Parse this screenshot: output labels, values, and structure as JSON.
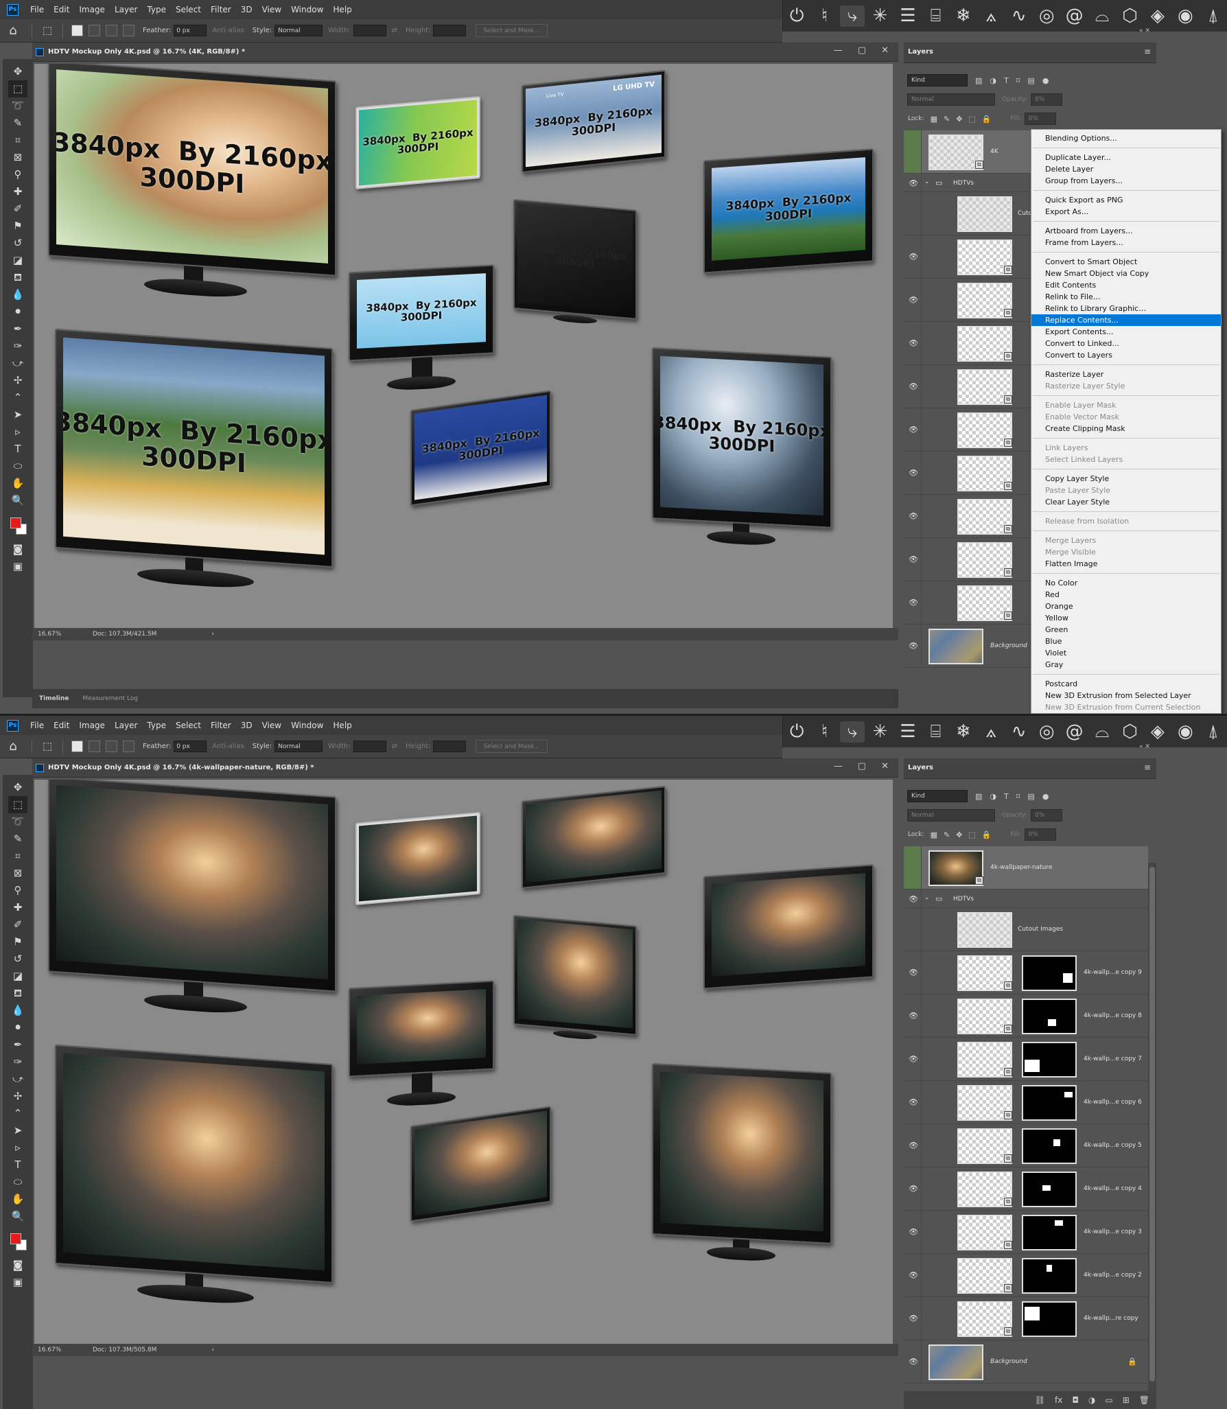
{
  "app": {
    "logo": "Ps"
  },
  "menu": [
    "File",
    "Edit",
    "Image",
    "Layer",
    "Type",
    "Select",
    "Filter",
    "3D",
    "View",
    "Window",
    "Help"
  ],
  "options_bar": {
    "feather_label": "Feather:",
    "feather_value": "0 px",
    "anti_alias_label": "Anti-alias",
    "style_label": "Style:",
    "style_value": "Normal",
    "width_label": "Width:",
    "height_label": "Height:",
    "select_mask_label": "Select and Mask..."
  },
  "top_window": {
    "doc_title": "HDTV Mockup Only 4K.psd @ 16.7% (4K, RGB/8#) *",
    "zoom": "16.67%",
    "doc_size": "Doc: 107.3M/421.5M",
    "tv_labels": [
      "3840px  By 2160px\n300DPI",
      "3840px  By 2160px\n300DPI",
      "3840px  By 2160px\n300DPI",
      "3840px  By 2160px\n300DPI",
      "3840px  By 2160px\n300DPI",
      "3840px  By 2160px\n300DPI",
      "3840px  By 2160px\n300DPI",
      "3840px  By 2160px\n300DPI",
      "3840px  By 2160px\n300DPI"
    ],
    "lg_text": "LG UHD TV",
    "live_tv_text": "Live TV",
    "layers_tab": "Layers",
    "layers_kind": "Kind",
    "blend_mode": "Normal",
    "opacity_label": "Opacity:",
    "opacity_value": "0%",
    "lock_label": "Lock:",
    "fill_label": "Fill:",
    "fill_value": "0%",
    "selected_layer": "4K",
    "group_layer": "HDTVs",
    "cutout_layer": "Cuto",
    "background_layer": "Background",
    "bottom_tabs": [
      "Timeline",
      "Measurement Log"
    ]
  },
  "context_menu": {
    "groups": [
      [
        "Blending Options..."
      ],
      [
        "Duplicate Layer...",
        "Delete Layer",
        "Group from Layers..."
      ],
      [
        "Quick Export as PNG",
        "Export As..."
      ],
      [
        "Artboard from Layers...",
        "Frame from Layers..."
      ],
      [
        "Convert to Smart Object",
        "New Smart Object via Copy",
        "Edit Contents",
        "Relink to File...",
        "Relink to Library Graphic...",
        "Replace Contents...",
        "Export Contents...",
        "Convert to Linked...",
        "Convert to Layers"
      ],
      [
        "Rasterize Layer",
        "Rasterize Layer Style"
      ],
      [
        "Enable Layer Mask",
        "Enable Vector Mask",
        "Create Clipping Mask"
      ],
      [
        "Link Layers",
        "Select Linked Layers"
      ],
      [
        "Copy Layer Style",
        "Paste Layer Style",
        "Clear Layer Style"
      ],
      [
        "Release from Isolation"
      ],
      [
        "Merge Layers",
        "Merge Visible",
        "Flatten Image"
      ],
      [
        "No Color",
        "Red",
        "Orange",
        "Yellow",
        "Green",
        "Blue",
        "Violet",
        "Gray"
      ],
      [
        "Postcard",
        "New 3D Extrusion from Selected Layer",
        "New 3D Extrusion from Current Selection"
      ]
    ],
    "highlighted": "Replace Contents...",
    "disabled": [
      "Rasterize Layer Style",
      "Enable Layer Mask",
      "Enable Vector Mask",
      "Link Layers",
      "Select Linked Layers",
      "Paste Layer Style",
      "Release from Isolation",
      "Merge Layers",
      "Merge Visible",
      "New 3D Extrusion from Current Selection"
    ]
  },
  "bottom_window": {
    "doc_title": "HDTV Mockup Only 4K.psd @ 16.7% (4k-wallpaper-nature, RGB/8#) *",
    "zoom": "16.67%",
    "doc_size": "Doc: 107.3M/505.8M",
    "layers_tab": "Layers",
    "layers_kind": "Kind",
    "blend_mode": "Normal",
    "opacity_label": "Opacity:",
    "opacity_value": "0%",
    "lock_label": "Lock:",
    "fill_label": "Fill:",
    "fill_value": "0%",
    "selected_layer": "4k-wallpaper-nature",
    "group_layer": "HDTVs",
    "cutout_layer": "Cutout Images",
    "layers": [
      "4k-wallp...e copy 9",
      "4k-wallp...e copy 8",
      "4k-wallp...e copy 7",
      "4k-wallp...e copy 6",
      "4k-wallp...e copy 5",
      "4k-wallp...e copy 4",
      "4k-wallp...e copy 3",
      "4k-wallp...e copy 2",
      "4k-wallp...re copy"
    ],
    "background_layer": "Background"
  }
}
